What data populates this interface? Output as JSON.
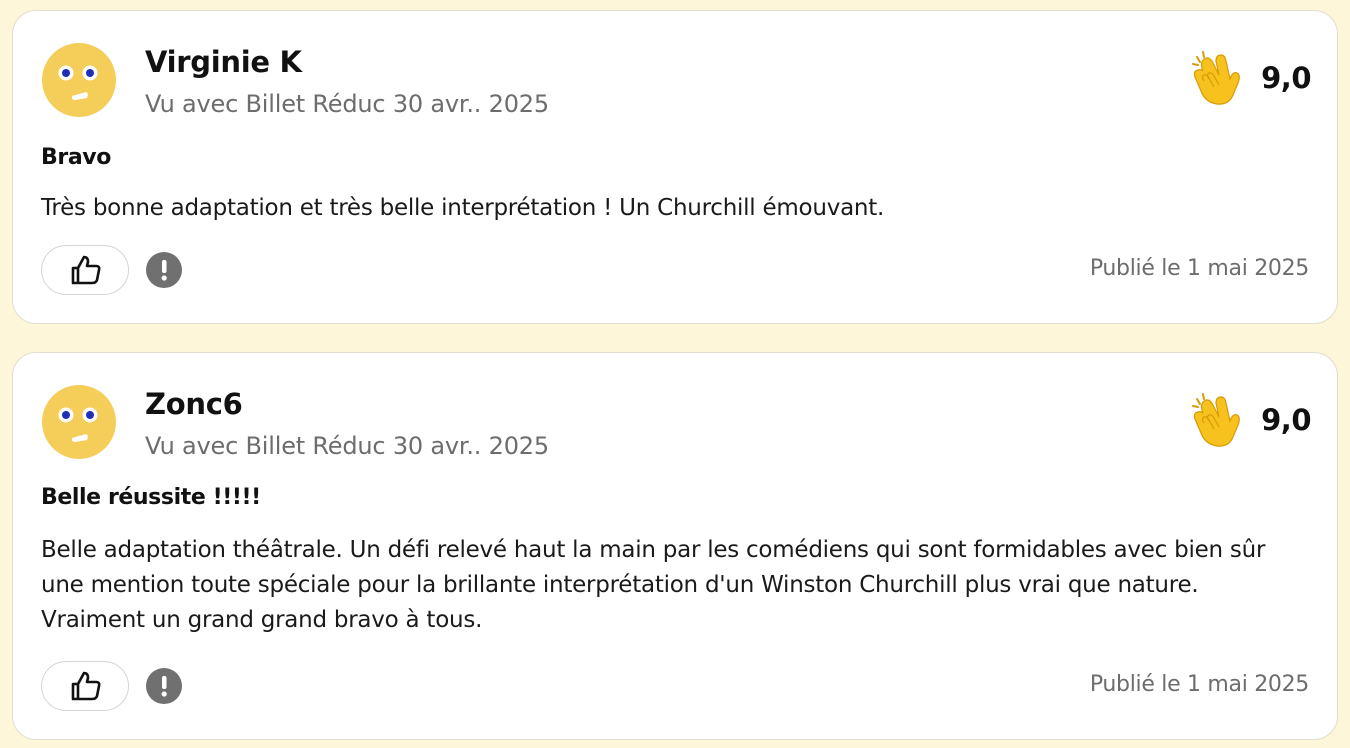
{
  "reviews": [
    {
      "username": "Virginie K",
      "meta": "Vu avec Billet Réduc 30 avr.. 2025",
      "score": "9,0",
      "score_icon": "clapping-hands-icon",
      "title": "Bravo",
      "body": "Très bonne adaptation et très belle interprétation ! Un Churchill émouvant.",
      "published": "Publié le 1 mai 2025"
    },
    {
      "username": "Zonc6",
      "meta": "Vu avec Billet Réduc 30 avr.. 2025",
      "score": "9,0",
      "score_icon": "clapping-hands-icon",
      "title": "Belle réussite !!!!!",
      "body": "Belle adaptation théâtrale. Un défi relevé haut la main par les comédiens qui sont formidables avec bien sûr une mention toute spéciale pour la brillante interprétation d'un Winston Churchill plus vrai que nature. Vraiment un grand grand bravo à tous.",
      "published": "Publié le 1 mai 2025"
    }
  ],
  "colors": {
    "page_background": "#fdf6d8",
    "card_background": "#ffffff",
    "avatar_yellow": "#f5ce5a",
    "eye_blue": "#1f2fb8",
    "muted_text": "#6d6d6d",
    "report_gray": "#707070",
    "clap_yellow": "#f7c21e"
  },
  "icons": {
    "like": "thumbs-up-icon",
    "report": "exclamation-icon",
    "avatar": "smiley-avatar-icon"
  }
}
